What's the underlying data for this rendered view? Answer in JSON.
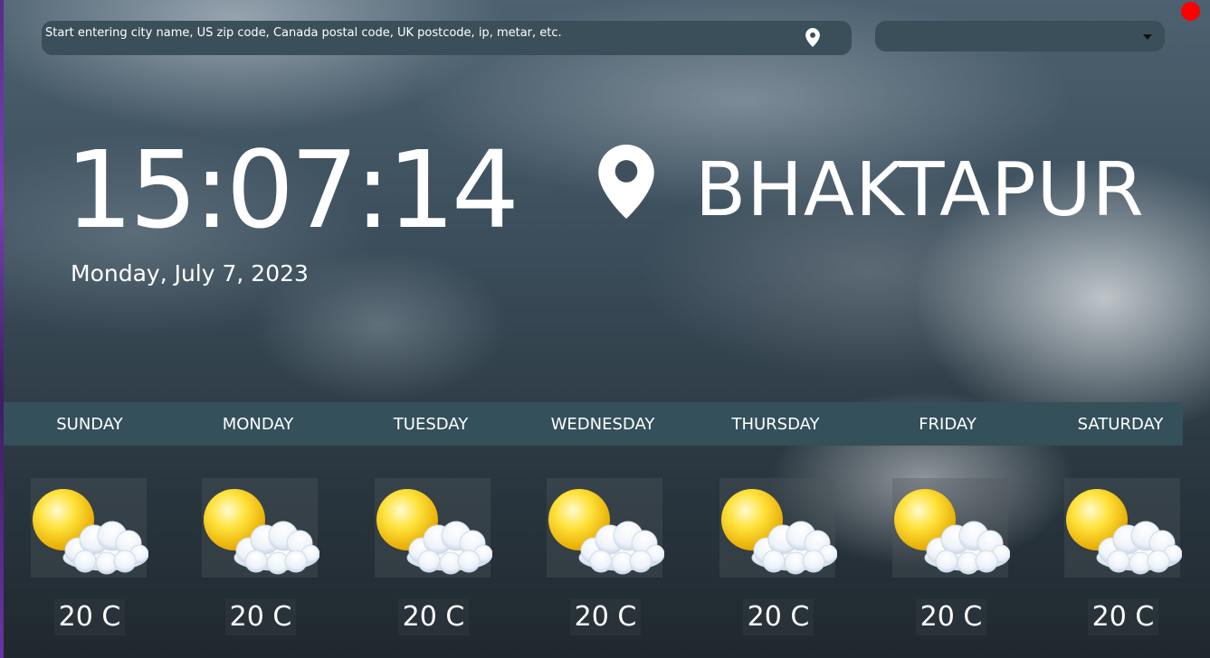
{
  "search": {
    "placeholder": "Start entering city name, US zip code, Canada postal code, UK postcode, ip, metar, etc.",
    "value": "",
    "location_icon": "map-pin-icon"
  },
  "units_select": {
    "selected": "",
    "icon": "caret-down-icon"
  },
  "window": {
    "close_dot_color": "#ff0000"
  },
  "clock": {
    "time": "15:07:14",
    "date": "Monday, July 7, 2023"
  },
  "location": {
    "icon": "map-pin-icon",
    "city": "BHAKTAPUR"
  },
  "forecast": [
    {
      "day": "SUNDAY",
      "icon": "partly-cloudy-icon",
      "temp": "20 C"
    },
    {
      "day": "MONDAY",
      "icon": "partly-cloudy-icon",
      "temp": "20 C"
    },
    {
      "day": "TUESDAY",
      "icon": "partly-cloudy-icon",
      "temp": "20 C"
    },
    {
      "day": "WEDNESDAY",
      "icon": "partly-cloudy-icon",
      "temp": "20 C"
    },
    {
      "day": "THURSDAY",
      "icon": "partly-cloudy-icon",
      "temp": "20 C"
    },
    {
      "day": "FRIDAY",
      "icon": "partly-cloudy-icon",
      "temp": "20 C"
    },
    {
      "day": "SATURDAY",
      "icon": "partly-cloudy-icon",
      "temp": "20 C"
    }
  ],
  "colors": {
    "bar": "#34505a",
    "sun": "#ffd21e",
    "cloud": "#f4f7fb"
  }
}
